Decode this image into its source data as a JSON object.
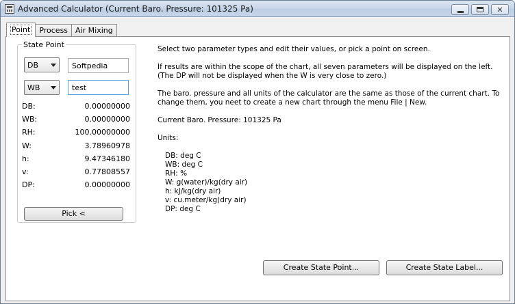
{
  "window": {
    "title": "Advanced Calculator (Current Baro. Pressure: 101325 Pa)"
  },
  "tabs": [
    {
      "label": "Point"
    },
    {
      "label": "Process"
    },
    {
      "label": "Air Mixing"
    }
  ],
  "state_point": {
    "group_title": "State Point",
    "param1": {
      "type": "DB",
      "value": "Softpedia"
    },
    "param2": {
      "type": "WB",
      "value": "test"
    },
    "rows": [
      {
        "label": "DB:",
        "value": "0.00000000"
      },
      {
        "label": "WB:",
        "value": "0.00000000"
      },
      {
        "label": "RH:",
        "value": "100.00000000"
      },
      {
        "label": "W:",
        "value": "3.78960978"
      },
      {
        "label": "h:",
        "value": "9.47346180"
      },
      {
        "label": "v:",
        "value": "0.77808557"
      },
      {
        "label": "DP:",
        "value": "0.00000000"
      }
    ],
    "pick_label": "Pick <"
  },
  "info": {
    "p1": "Select two parameter types and edit their values, or pick a point on screen.",
    "p2": "If results are within the scope of the chart, all seven parameters will be displayed on the left. (The DP will not be displayed when the W is very close to zero.)",
    "p3": "The baro. pressure and all units of the calculator are the same as those of the current chart. To change them, you neet to create a new chart through the menu File | New.",
    "p4": "Current Baro. Pressure: 101325 Pa",
    "units_heading": "Units:",
    "units": [
      "DB: deg C",
      "WB: deg C",
      "RH: %",
      "W: g(water)/kg(dry air)",
      "h: kJ/kg(dry air)",
      "v: cu.meter/kg(dry air)",
      "DP: deg C"
    ]
  },
  "buttons": {
    "create_state_point": "Create State Point...",
    "create_state_label": "Create State Label..."
  }
}
